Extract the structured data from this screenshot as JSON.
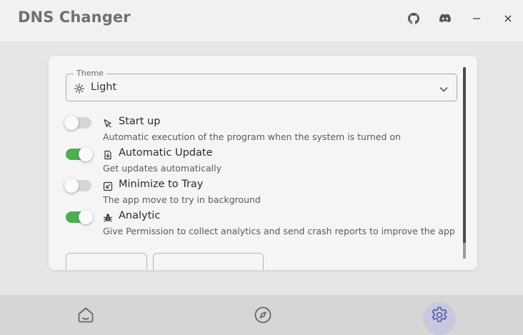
{
  "app": {
    "title": "DNS Changer"
  },
  "titlebar": {
    "icons": [
      "github-icon",
      "discord-icon",
      "minimize-icon",
      "close-icon"
    ]
  },
  "settings": {
    "theme": {
      "label": "Theme",
      "value": "Light",
      "icon": "sun-icon"
    },
    "options": [
      {
        "icon": "play-cursor-icon",
        "title": "Start up",
        "description": "Automatic execution of the program when the system is turned on",
        "enabled": false
      },
      {
        "icon": "download-update-icon",
        "title": "Automatic Update",
        "description": "Get updates automatically",
        "enabled": true
      },
      {
        "icon": "minimize-tray-icon",
        "title": "Minimize to Tray",
        "description": "The app move to try in background",
        "enabled": false
      },
      {
        "icon": "bug-icon",
        "title": "Analytic",
        "description": "Give Permission to collect analytics and send crash reports to improve the app",
        "enabled": true
      }
    ]
  },
  "bottom_nav": {
    "items": [
      "home-icon",
      "compass-icon",
      "settings-gear-icon"
    ],
    "active": "settings-gear-icon"
  },
  "colors": {
    "switch_on": "#4caf50",
    "switch_off": "#d6d6d6",
    "active_nav": "#5c5fb0",
    "active_nav_bg": "#c8c9de"
  }
}
